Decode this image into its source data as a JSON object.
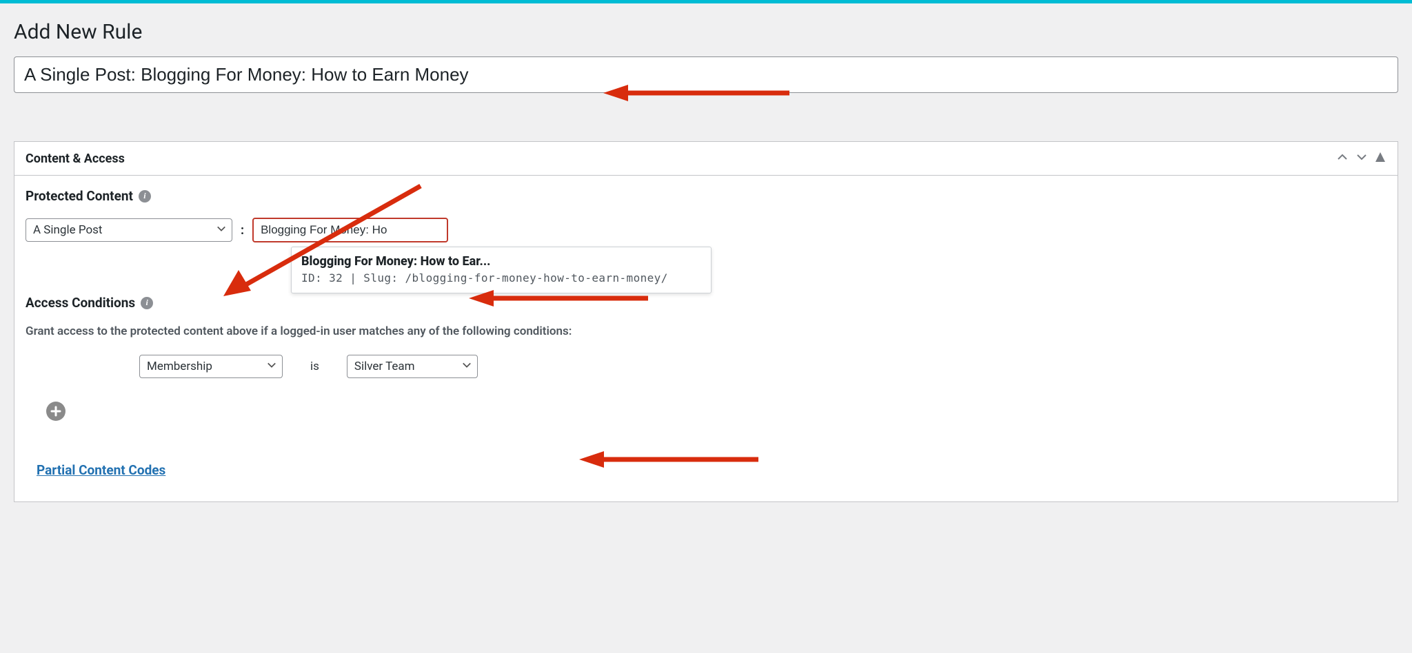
{
  "page": {
    "title": "Add New Rule",
    "rule_title_value": "A Single Post: Blogging For Money: How to Earn Money"
  },
  "panel": {
    "header_title": "Content & Access"
  },
  "protected": {
    "label": "Protected Content",
    "type_select_value": "A Single Post",
    "search_input_value": "Blogging For Money: Ho",
    "dropdown": {
      "title": "Blogging For Money: How to Ear...",
      "meta": "ID: 32 | Slug: /blogging-for-money-how-to-earn-money/"
    }
  },
  "access": {
    "label": "Access Conditions",
    "grant_text": "Grant access to the protected content above if a logged-in user matches any of the following conditions:",
    "condition": {
      "type_select_value": "Membership",
      "operator_text": "is",
      "value_select_value": "Silver Team"
    }
  },
  "links": {
    "partial_codes": "Partial Content Codes"
  }
}
